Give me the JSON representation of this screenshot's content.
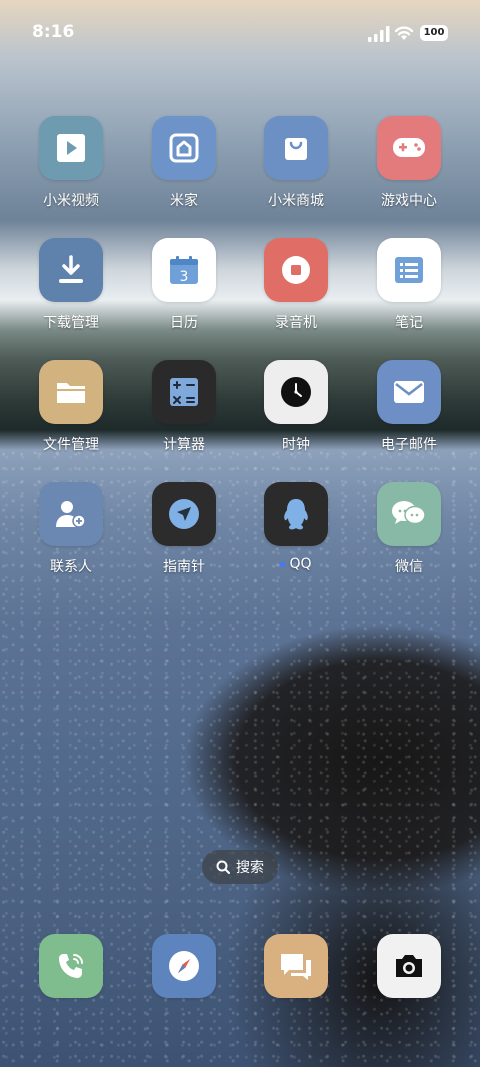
{
  "status_bar": {
    "time": "8:16",
    "battery": "100"
  },
  "apps": [
    {
      "label": "小米视频",
      "icon": "play-icon",
      "color": "#6f9bb0"
    },
    {
      "label": "米家",
      "icon": "home-icon",
      "color": "#6d93c9"
    },
    {
      "label": "小米商城",
      "icon": "shopping-bag-icon",
      "color": "#6c8fc4"
    },
    {
      "label": "游戏中心",
      "icon": "gamepad-icon",
      "color": "#e37a7c"
    },
    {
      "label": "下载管理",
      "icon": "download-icon",
      "color": "#5f82ac"
    },
    {
      "label": "日历",
      "icon": "calendar-icon",
      "color": "#ffffff",
      "day": "3"
    },
    {
      "label": "录音机",
      "icon": "record-icon",
      "color": "#e06e66"
    },
    {
      "label": "笔记",
      "icon": "notes-icon",
      "color": "#ffffff"
    },
    {
      "label": "文件管理",
      "icon": "folder-icon",
      "color": "#d2b27f"
    },
    {
      "label": "计算器",
      "icon": "calculator-icon",
      "color": "#2a2a2a"
    },
    {
      "label": "时钟",
      "icon": "clock-icon",
      "color": "#eeeeee"
    },
    {
      "label": "电子邮件",
      "icon": "mail-icon",
      "color": "#6d8fc6"
    },
    {
      "label": "联系人",
      "icon": "contact-icon",
      "color": "#6b88b3"
    },
    {
      "label": "指南针",
      "icon": "compass-arrow-icon",
      "color": "#2c2c2c"
    },
    {
      "label": "QQ",
      "icon": "qq-penguin-icon",
      "color": "#2b2b2b"
    },
    {
      "label": "微信",
      "icon": "chat-bubbles-icon",
      "color": "#88b8a6"
    }
  ],
  "search_label": "搜索",
  "dock": [
    {
      "icon": "phone-icon",
      "color": "#7fbd8e"
    },
    {
      "icon": "browser-compass-icon",
      "color": "#5d84bd"
    },
    {
      "icon": "messages-icon",
      "color": "#d9b07f"
    },
    {
      "icon": "camera-icon",
      "color": "#f1f1f1"
    }
  ]
}
